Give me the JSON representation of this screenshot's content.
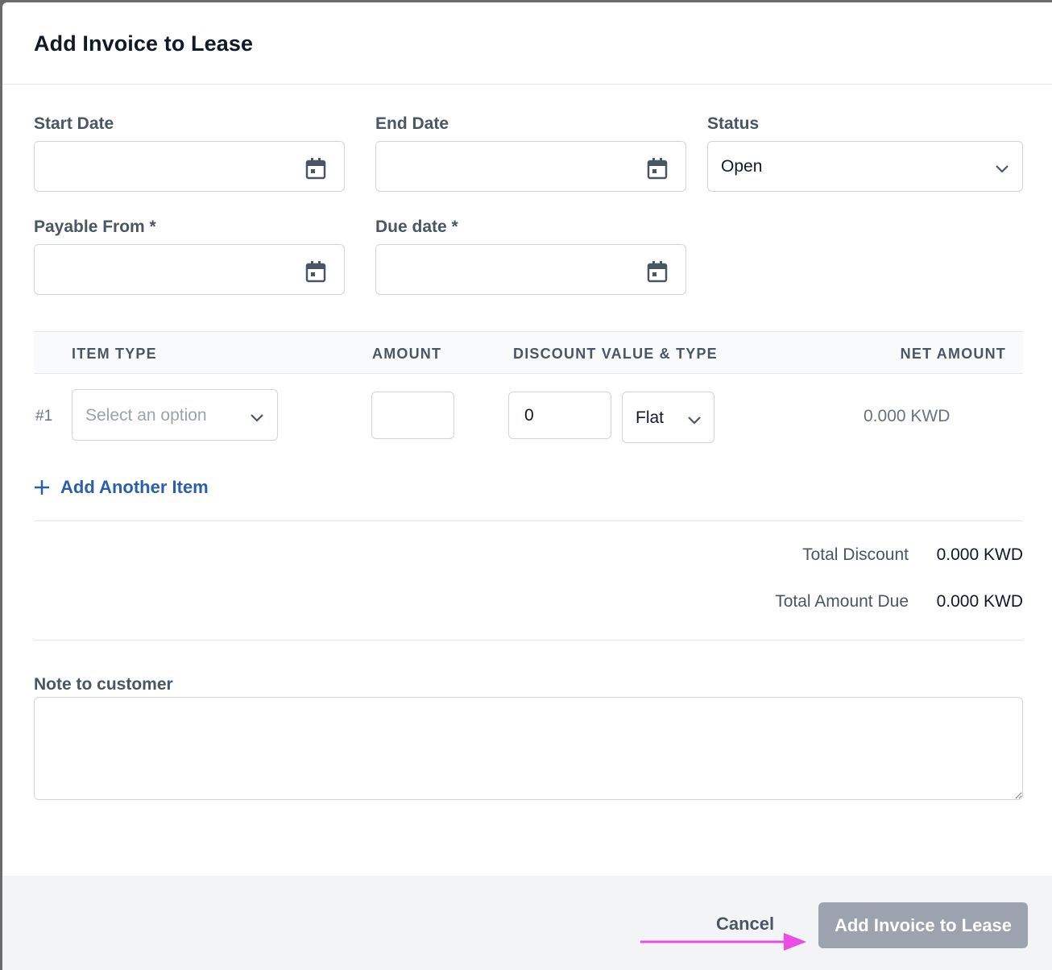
{
  "modal": {
    "title": "Add Invoice to Lease"
  },
  "form": {
    "start_date": {
      "label": "Start Date",
      "value": ""
    },
    "end_date": {
      "label": "End Date",
      "value": ""
    },
    "status": {
      "label": "Status",
      "value": "Open"
    },
    "payable_from": {
      "label": "Payable From *",
      "value": ""
    },
    "due_date": {
      "label": "Due date *",
      "value": ""
    }
  },
  "items_table": {
    "headers": {
      "item_type": "ITEM TYPE",
      "amount": "AMOUNT",
      "discount": "DISCOUNT VALUE & TYPE",
      "net_amount": "NET AMOUNT"
    },
    "rows": [
      {
        "number": "#1",
        "item_type_placeholder": "Select an option",
        "amount": "",
        "discount_value": "0",
        "discount_type": "Flat",
        "net_amount": "0.000 KWD"
      }
    ],
    "add_item_label": "Add Another Item"
  },
  "totals": {
    "discount_label": "Total Discount",
    "discount_value": "0.000 KWD",
    "due_label": "Total Amount Due",
    "due_value": "0.000 KWD"
  },
  "note": {
    "label": "Note to customer",
    "value": ""
  },
  "footer": {
    "cancel_label": "Cancel",
    "submit_label": "Add Invoice to Lease"
  },
  "colors": {
    "link": "#2b5fa8",
    "annotation_arrow": "#e94de6",
    "disabled_button": "#9ca3af"
  }
}
